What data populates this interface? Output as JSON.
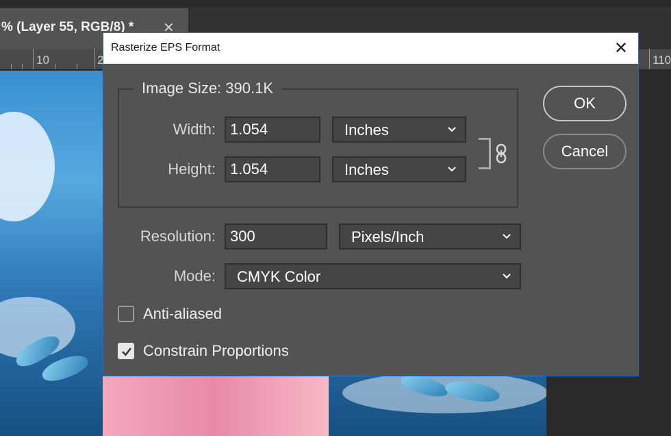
{
  "document_tab": {
    "title": "% (Layer 55, RGB/8) *",
    "close_glyph": "✕"
  },
  "ruler": {
    "labels": [
      "10",
      "2",
      "110"
    ]
  },
  "dialog": {
    "title": "Rasterize EPS Format",
    "close_glyph": "✕",
    "image_size_label": "Image Size: 390.1K",
    "width": {
      "label": "Width:",
      "value": "1.054",
      "unit": "Inches"
    },
    "height": {
      "label": "Height:",
      "value": "1.054",
      "unit": "Inches"
    },
    "resolution": {
      "label": "Resolution:",
      "value": "300",
      "unit": "Pixels/Inch"
    },
    "mode": {
      "label": "Mode:",
      "value": "CMYK Color"
    },
    "anti_aliased": {
      "label": "Anti-aliased",
      "checked": false
    },
    "constrain_proportions": {
      "label": "Constrain Proportions",
      "checked": true
    },
    "ok_label": "OK",
    "cancel_label": "Cancel",
    "link_icon": "chain-link-icon"
  },
  "colors": {
    "dialog_bg": "#535353",
    "dialog_border": "#1d6fc7",
    "field_bg": "#454545",
    "text": "#ffffff"
  }
}
